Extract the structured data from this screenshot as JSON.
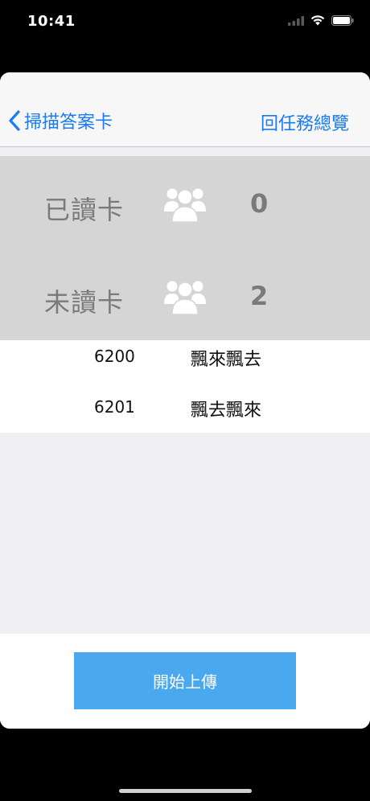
{
  "status_bar": {
    "time": "10:41",
    "icons": [
      "signal-icon",
      "wifi-icon",
      "battery-icon"
    ]
  },
  "nav": {
    "back_label": "掃描答案卡",
    "right_label": "回任務總覽"
  },
  "summary": {
    "read": {
      "label": "已讀卡",
      "count": "0",
      "icon": "users-icon"
    },
    "unread": {
      "label": "未讀卡",
      "count": "2",
      "icon": "users-icon"
    }
  },
  "cards": [
    {
      "id": "6200",
      "name": "飄來飄去"
    },
    {
      "id": "6201",
      "name": "飄去飄來"
    }
  ],
  "footer": {
    "upload_label": "開始上傳"
  },
  "colors": {
    "accent": "#1a7cf0",
    "button": "#4aa8ee",
    "summary_bg": "#d5d5d5",
    "summary_text": "#7a7a7a",
    "sheet_bg": "#efeff4"
  }
}
